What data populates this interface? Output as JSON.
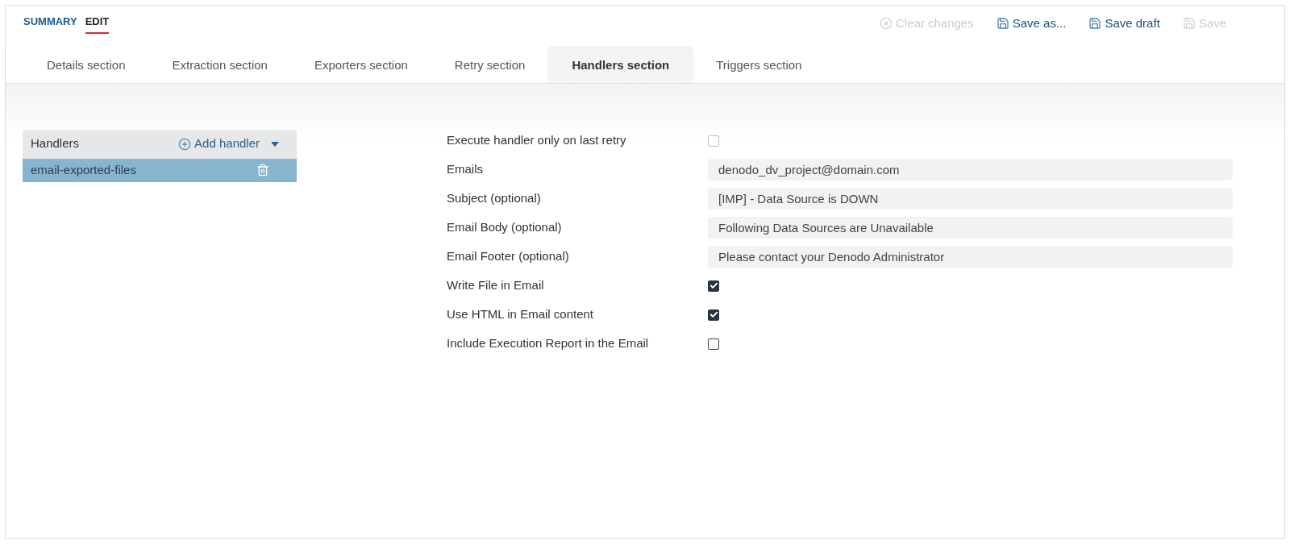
{
  "top_tabs": [
    {
      "label": "SUMMARY",
      "selected": false
    },
    {
      "label": "EDIT",
      "selected": true
    }
  ],
  "actions": [
    {
      "label": "Clear changes",
      "kind": "clear",
      "disabled": true
    },
    {
      "label": "Save as...",
      "kind": "save",
      "disabled": false
    },
    {
      "label": "Save draft",
      "kind": "save",
      "disabled": false
    },
    {
      "label": "Save",
      "kind": "save",
      "disabled": true
    }
  ],
  "section_tabs": [
    {
      "label": "Details section",
      "selected": false
    },
    {
      "label": "Extraction section",
      "selected": false
    },
    {
      "label": "Exporters section",
      "selected": false
    },
    {
      "label": "Retry section",
      "selected": false
    },
    {
      "label": "Handlers section",
      "selected": true
    },
    {
      "label": "Triggers section",
      "selected": false
    }
  ],
  "handlers": {
    "title": "Handlers",
    "add_label": "Add handler",
    "items": [
      {
        "name": "email-exported-files",
        "selected": true
      }
    ]
  },
  "fields": [
    {
      "label": "Execute handler only on last retry",
      "kind": "checkbox",
      "checked": false,
      "disabled": true
    },
    {
      "label": "Emails",
      "kind": "text",
      "value": "denodo_dv_project@domain.com"
    },
    {
      "label": "Subject (optional)",
      "kind": "text",
      "value": "[IMP] - Data Source is DOWN"
    },
    {
      "label": "Email Body (optional)",
      "kind": "text",
      "value": "Following Data Sources are Unavailable"
    },
    {
      "label": "Email Footer (optional)",
      "kind": "text",
      "value": "Please contact your Denodo Administrator"
    },
    {
      "label": "Write File in Email",
      "kind": "checkbox",
      "checked": true,
      "disabled": false
    },
    {
      "label": "Use HTML in Email content",
      "kind": "checkbox",
      "checked": true,
      "disabled": false
    },
    {
      "label": "Include Execution Report in the Email",
      "kind": "checkbox",
      "checked": false,
      "disabled": false
    }
  ]
}
